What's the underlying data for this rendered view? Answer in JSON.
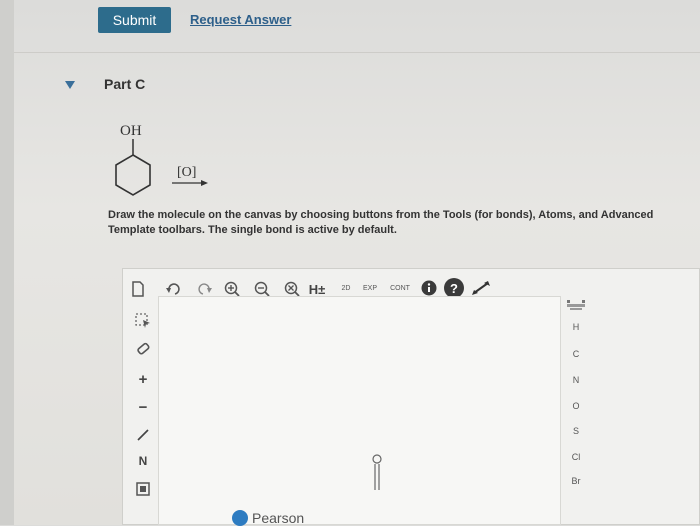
{
  "header": {
    "submit_label": "Submit",
    "request_label": "Request Answer"
  },
  "part": {
    "title": "Part C"
  },
  "reaction": {
    "substituent": "OH",
    "reagent": "[O]"
  },
  "instructions": "Draw the molecule on the canvas by choosing buttons from the Tools (for bonds), Atoms, and Advanced\nTemplate toolbars. The single bond is active by default.",
  "toolbar": {
    "h_label": "H±",
    "label_2d": "2D",
    "label_exp": "EXP",
    "label_cont": "CONT",
    "help_label": "?"
  },
  "left_tools": {
    "plus_label": "+",
    "minus_label": "−",
    "n_label": "N"
  },
  "atoms": [
    "H",
    "C",
    "N",
    "O",
    "S",
    "Cl",
    "Br"
  ],
  "footer": {
    "brand": "Pearson"
  },
  "colors": {
    "submit_bg": "#2d6c8c",
    "link": "#2d5f8a",
    "accent_blue": "#2e7cc1",
    "info_dark": "#3a3a3a"
  }
}
